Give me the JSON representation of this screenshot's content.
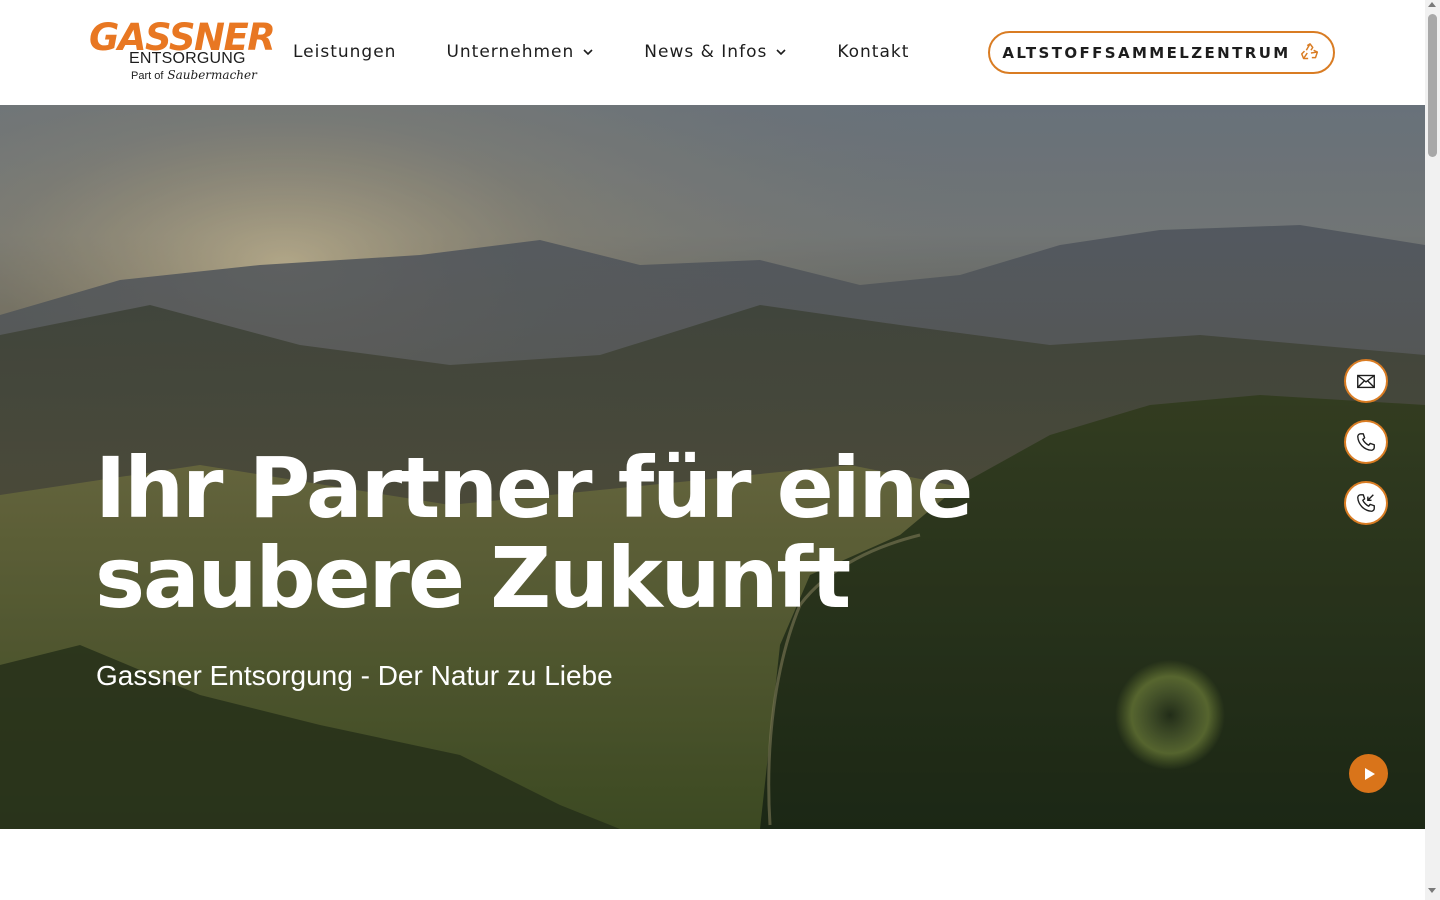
{
  "brand": {
    "logo_main": "GASSNER",
    "logo_sub": "ENTSORGUNG",
    "logo_part_prefix": "Part of",
    "logo_part_brand": "Saubermacher",
    "accent_color": "#d97c23"
  },
  "nav": {
    "items": [
      {
        "label": "Leistungen",
        "has_dropdown": false
      },
      {
        "label": "Unternehmen",
        "has_dropdown": true
      },
      {
        "label": "News & Infos",
        "has_dropdown": true
      },
      {
        "label": "Kontakt",
        "has_dropdown": false
      }
    ]
  },
  "cta": {
    "label": "ALTSTOFFSAMMELZENTRUM",
    "icon": "recycle-icon"
  },
  "hero": {
    "title_line1": "Ihr Partner für eine",
    "title_line2": "saubere Zukunft",
    "subtitle": "Gassner Entsorgung - Der Natur zu Liebe"
  },
  "side_actions": [
    {
      "icon": "mail-icon"
    },
    {
      "icon": "phone-icon"
    },
    {
      "icon": "callback-icon"
    }
  ],
  "video": {
    "icon": "play-icon"
  }
}
